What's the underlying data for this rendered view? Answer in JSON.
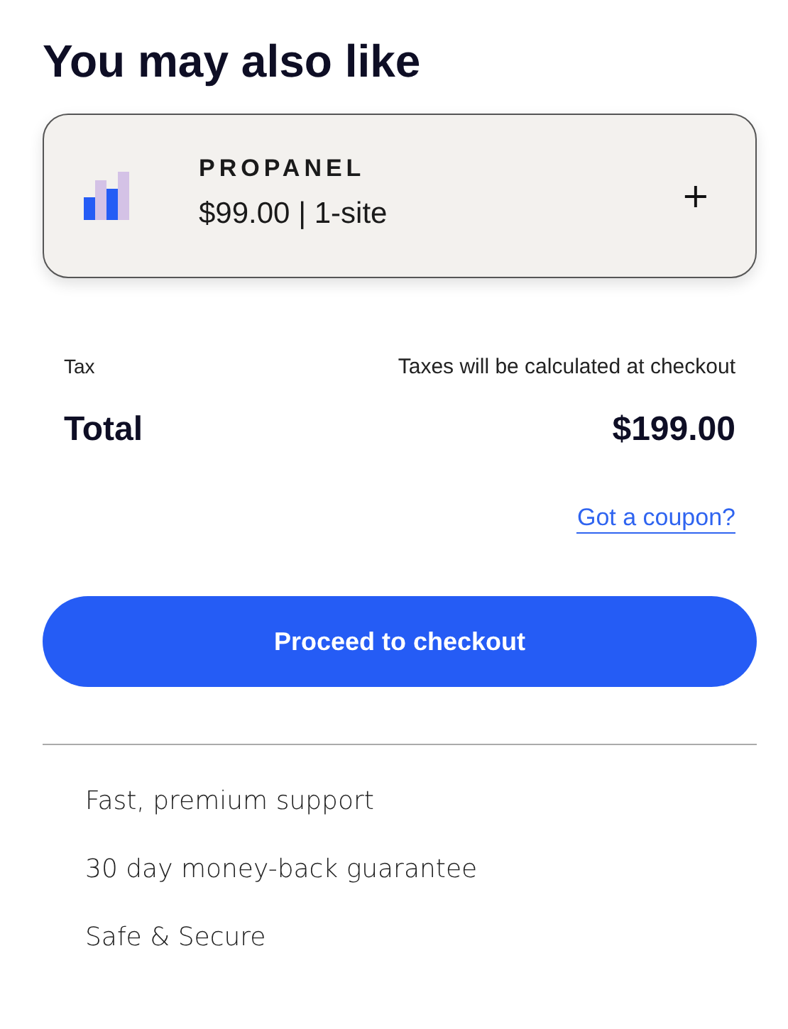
{
  "heading": "You may also like",
  "upsell": {
    "name": "PROPANEL",
    "price": "$99.00 | 1-site",
    "add": "+"
  },
  "tax": {
    "label": "Tax",
    "value": "Taxes will be calculated at checkout"
  },
  "total": {
    "label": "Total",
    "value": "$199.00"
  },
  "coupon_link": "Got a coupon?",
  "checkout_button": "Proceed to checkout",
  "features": [
    "Fast, premium support",
    "30 day money-back guarantee",
    "Safe & Secure"
  ]
}
